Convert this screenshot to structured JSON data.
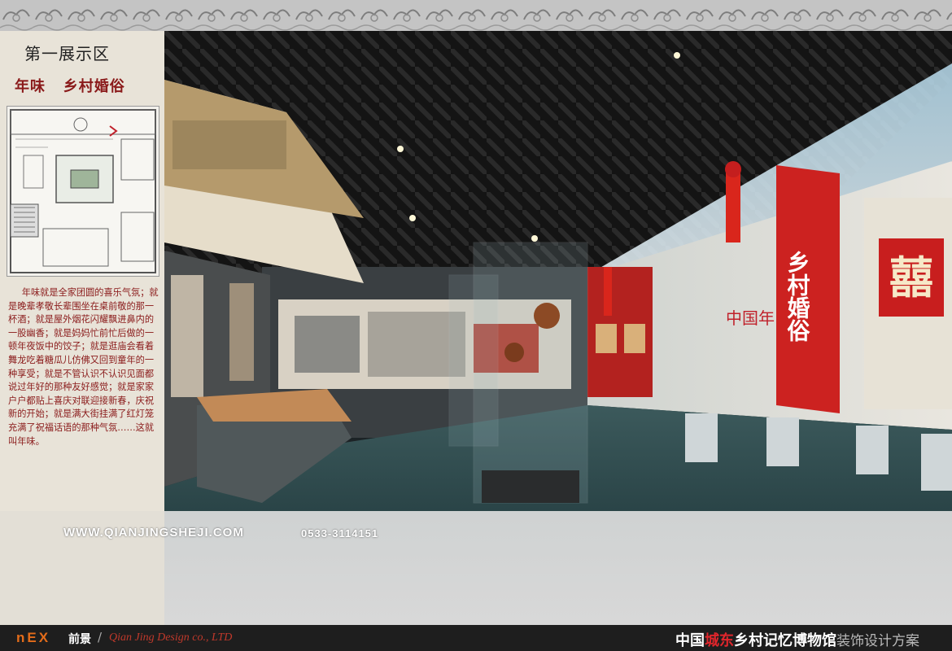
{
  "header": {
    "section_label": "第一展示区",
    "subtitle": "年味   乡村婚俗"
  },
  "description": "年味就是全家团圆的喜乐气氛；就是晚辈孝敬长辈围坐在桌前敬的那一杯酒；就是屋外烟花闪耀飘进鼻内的一股幽香；就是妈妈忙前忙后做的一顿年夜饭中的饺子；就是逛庙会看着舞龙吃着糖瓜儿仿佛又回到童年的一种享受；就是不管认识不认识见面都说过年好的那种友好感觉；就是家家户户都贴上喜庆对联迎接新春，庆祝新的开始；就是满大街挂满了红灯笼充满了祝福话语的那种气氛……这就叫年味。",
  "scene": {
    "wall_title": "乡村婚俗",
    "wall_sign": "中国年",
    "xi_character": "囍"
  },
  "watermark": {
    "website": "WWW.QIANJINGSHEJI.COM",
    "phone": "0533-3114151"
  },
  "footer": {
    "logo": "nEX",
    "logo_cn": "前景",
    "company": "Qian Jing Design co., LTD",
    "title_part1": "中国",
    "title_part2": "城东",
    "title_part3": "乡村记忆博物馆",
    "title_part4": "装饰设计方案"
  },
  "colors": {
    "accent_red": "#e1262c",
    "text_dark_red": "#8a1a1a",
    "logo_orange": "#e36c1a"
  }
}
